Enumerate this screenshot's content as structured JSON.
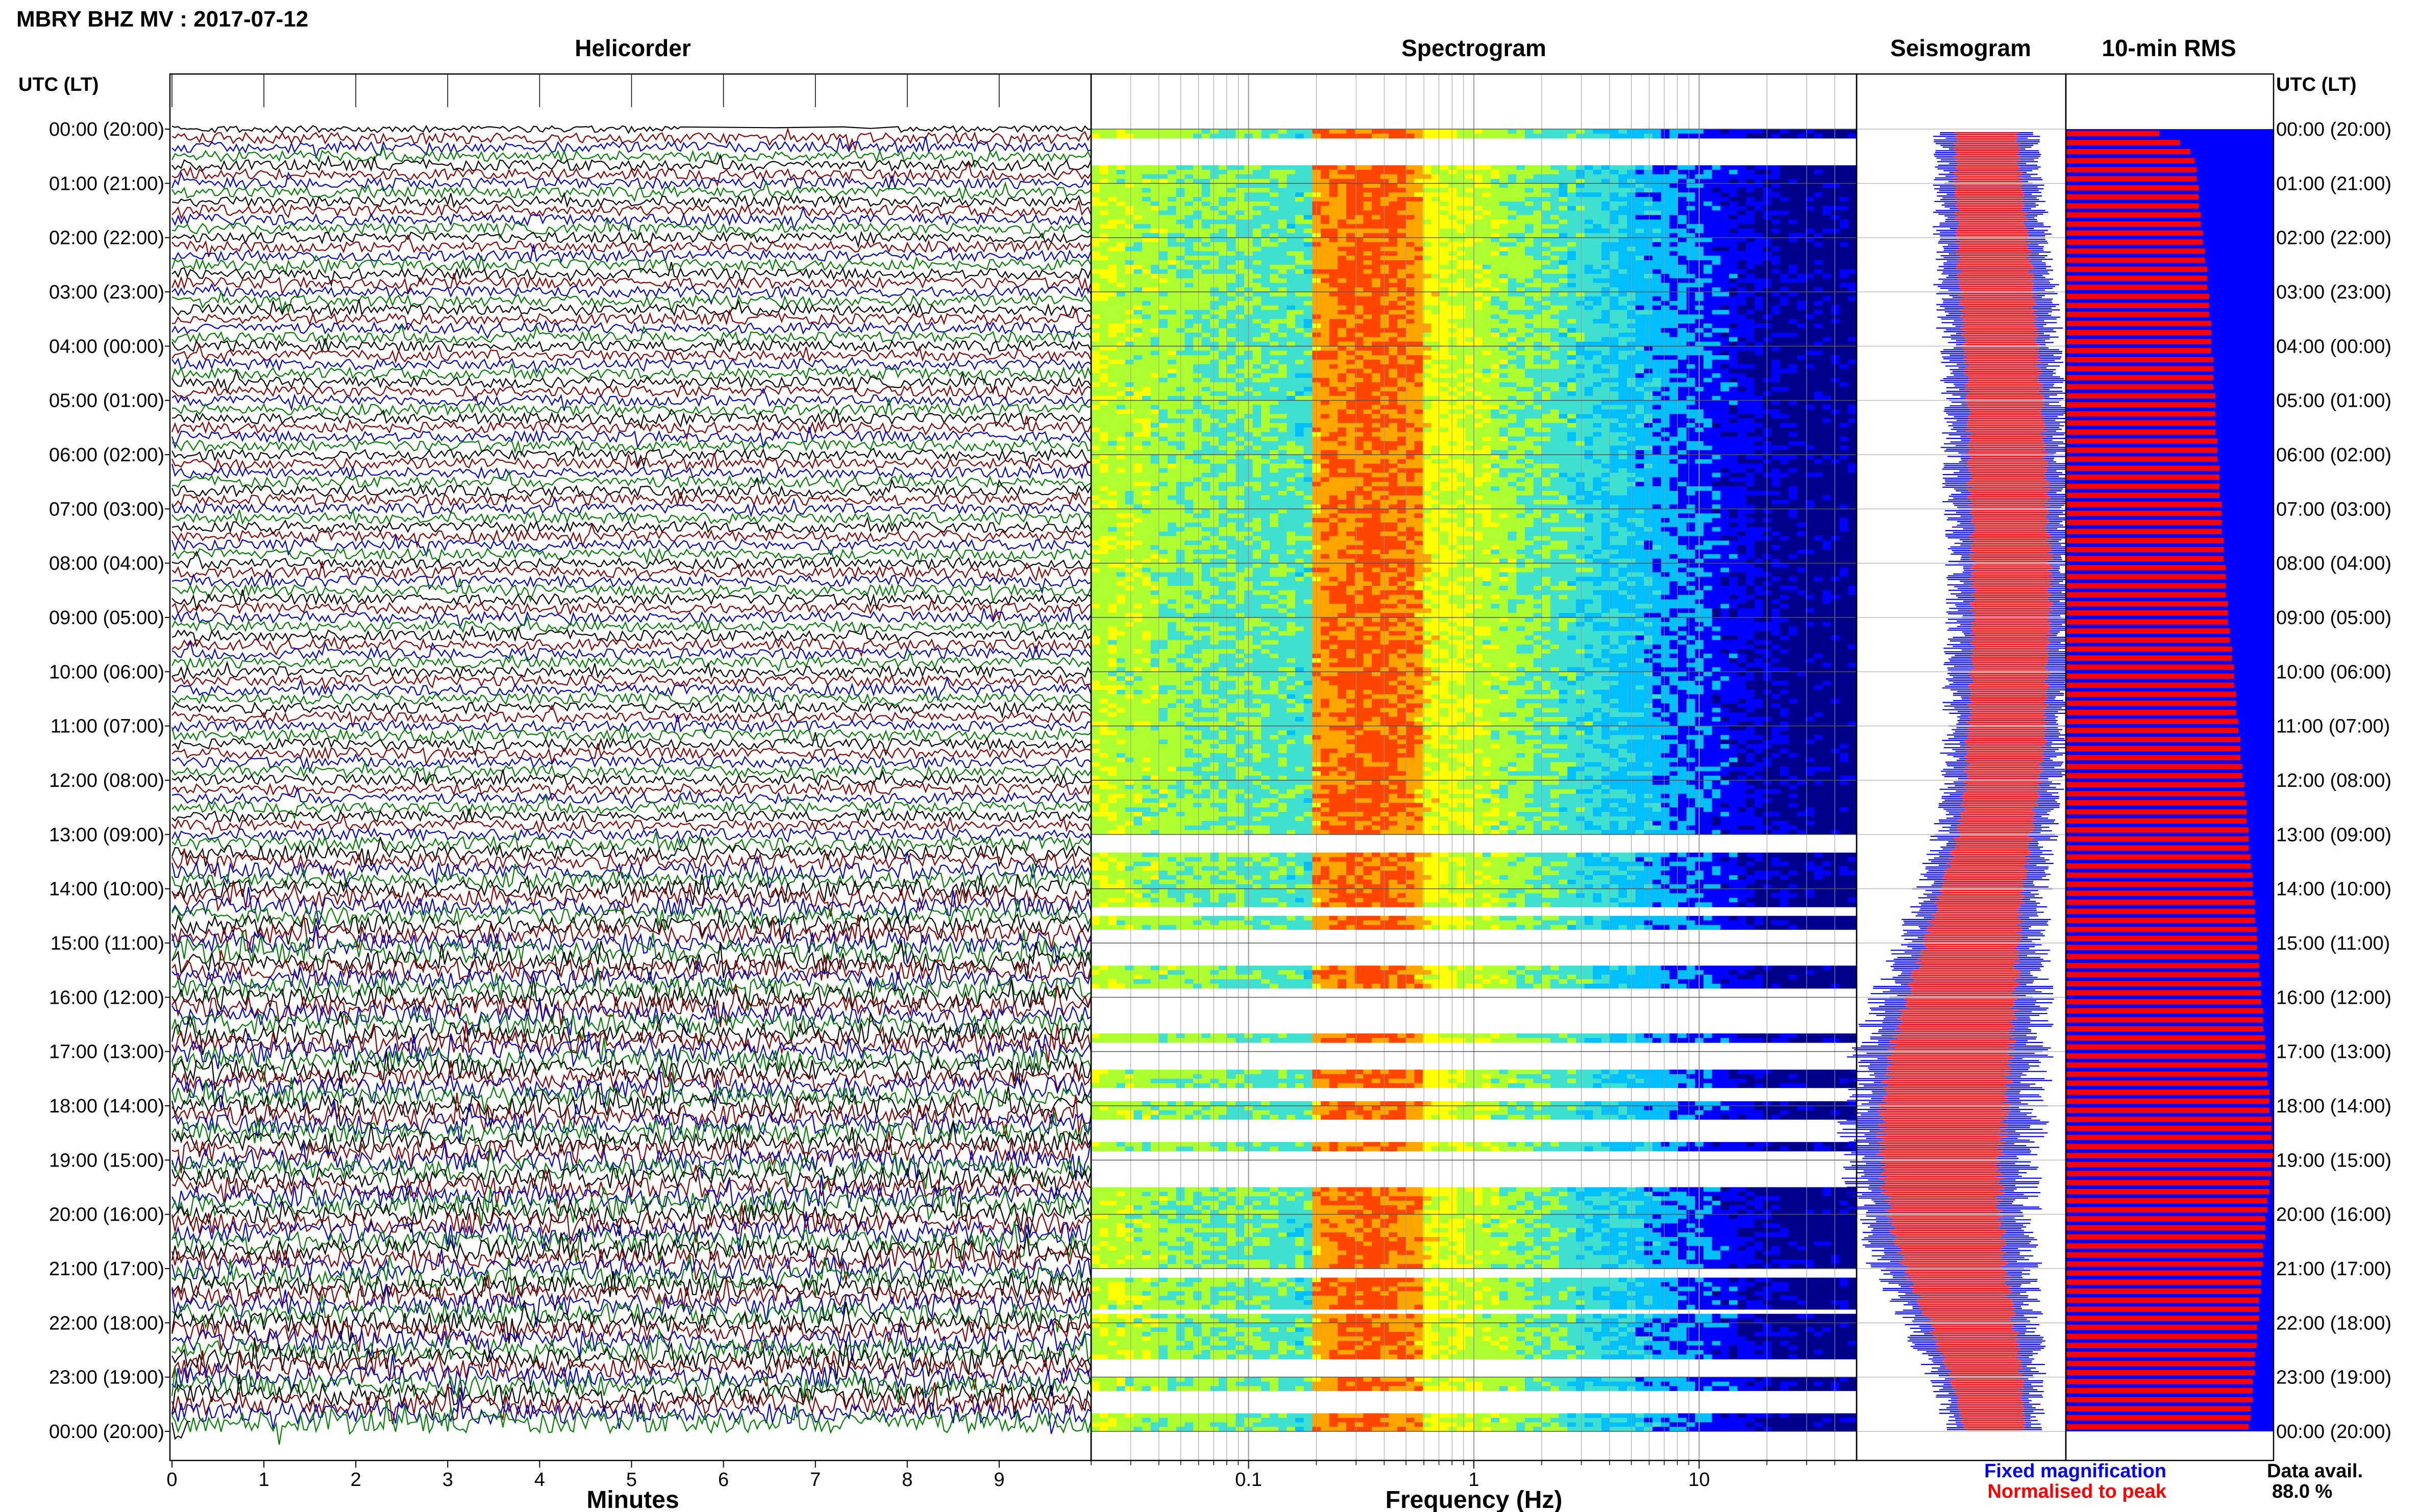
{
  "header": {
    "title": "MBRY BHZ MV : 2017-07-12"
  },
  "colors": {
    "trace_cycle": [
      "#000000",
      "#8b0000",
      "#0000cc",
      "#008000"
    ],
    "fixed_magnification": "#0000ff",
    "normalised_to_peak": "#ff0000",
    "spectrogram_colormap": [
      "#00008b",
      "#0000ff",
      "#00bfff",
      "#40e0d0",
      "#adff2f",
      "#ffff00",
      "#ffa500",
      "#ff4500"
    ]
  },
  "panels": {
    "helicorder": {
      "title": "Helicorder",
      "xlabel": "Minutes"
    },
    "spectrogram": {
      "title": "Spectrogram",
      "xlabel": "Frequency (Hz)"
    },
    "seismogram": {
      "title": "Seismogram"
    },
    "rms": {
      "title": "10-min RMS"
    }
  },
  "axis": {
    "left_header": "UTC (LT)",
    "right_header": "UTC (LT)",
    "time_labels": [
      "00:00 (20:00)",
      "01:00 (21:00)",
      "02:00 (22:00)",
      "03:00 (23:00)",
      "04:00 (00:00)",
      "05:00 (01:00)",
      "06:00 (02:00)",
      "07:00 (03:00)",
      "08:00 (04:00)",
      "09:00 (05:00)",
      "10:00 (06:00)",
      "11:00 (07:00)",
      "12:00 (08:00)",
      "13:00 (09:00)",
      "14:00 (10:00)",
      "15:00 (11:00)",
      "16:00 (12:00)",
      "17:00 (13:00)",
      "18:00 (14:00)",
      "19:00 (15:00)",
      "20:00 (16:00)",
      "21:00 (17:00)",
      "22:00 (18:00)",
      "23:00 (19:00)",
      "00:00 (20:00)"
    ],
    "minute_ticks": [
      "0",
      "1",
      "2",
      "3",
      "4",
      "5",
      "6",
      "7",
      "8",
      "9"
    ],
    "freq_ticks": [
      "0.1",
      "1",
      "10"
    ]
  },
  "legend": {
    "fixed": "Fixed magnification",
    "normalised": "Normalised to peak",
    "avail_label": "Data avail.",
    "avail_value": "88.0 %"
  },
  "chart_data": [
    {
      "type": "line",
      "title": "Helicorder",
      "xlabel": "Minutes",
      "ylabel": "UTC (LT)",
      "xlim": [
        0,
        10
      ],
      "ylim": [
        0,
        24
      ],
      "rows_per_hour": 6,
      "row_duration_minutes": 10,
      "row_activity": [
        0.15,
        0.55,
        0.55,
        0.55,
        0.55,
        0.55,
        0.55,
        0.55,
        0.55,
        0.55,
        0.55,
        0.55,
        0.55,
        0.55,
        0.55,
        0.55,
        0.55,
        0.55,
        0.55,
        0.55,
        0.55,
        0.55,
        0.55,
        0.55,
        0.55,
        0.55,
        0.55,
        0.55,
        0.55,
        0.55,
        0.55,
        0.55,
        0.55,
        0.55,
        0.55,
        0.55,
        0.55,
        0.55,
        0.55,
        0.55,
        0.55,
        0.55,
        0.55,
        0.55,
        0.55,
        0.55,
        0.55,
        0.55,
        0.55,
        0.55,
        0.55,
        0.55,
        0.55,
        0.55,
        0.55,
        0.55,
        0.55,
        0.55,
        0.55,
        0.55,
        0.55,
        0.55,
        0.55,
        0.55,
        0.55,
        0.55,
        0.55,
        0.55,
        0.55,
        0.55,
        0.55,
        0.55,
        0.55,
        0.55,
        0.55,
        0.55,
        0.55,
        0.55,
        0.6,
        0.7,
        0.75,
        0.8,
        0.85,
        0.8,
        0.85,
        0.9,
        0.9,
        0.85,
        0.9,
        0.95,
        1,
        1,
        0.95,
        1,
        0.9,
        1,
        1,
        1,
        1,
        1,
        1,
        1,
        1,
        1,
        1,
        0.9,
        1,
        0.95,
        1,
        1,
        1,
        1,
        1,
        1,
        1,
        1,
        1,
        1,
        1,
        1,
        1,
        1,
        1,
        1,
        1,
        1,
        1,
        1,
        1,
        1,
        1,
        1,
        1,
        1,
        1,
        1,
        1,
        1,
        1,
        1,
        1,
        1,
        1,
        1
      ]
    },
    {
      "type": "heatmap",
      "title": "Spectrogram",
      "xlabel": "Frequency (Hz)",
      "xscale": "log",
      "xlim": [
        0.02,
        50
      ],
      "ylim": [
        0,
        24
      ],
      "dominant_band_hz": [
        0.2,
        0.6
      ],
      "missing_hour_ranges": [
        [
          0.1,
          0.6
        ],
        [
          13.0,
          13.3
        ],
        [
          14.3,
          14.5
        ],
        [
          14.7,
          15.4
        ],
        [
          15.8,
          16.6
        ],
        [
          16.8,
          17.3
        ],
        [
          17.6,
          17.9
        ],
        [
          18.2,
          18.6
        ],
        [
          18.8,
          19.5
        ],
        [
          21.0,
          21.1
        ],
        [
          21.7,
          21.8
        ],
        [
          22.6,
          23.0
        ],
        [
          23.2,
          23.6
        ]
      ]
    },
    {
      "type": "area",
      "title": "Seismogram",
      "ylim": [
        0,
        24
      ],
      "series": [
        {
          "name": "Fixed magnification",
          "color": "#0000ff"
        },
        {
          "name": "Normalised to peak",
          "color": "#ff0000"
        }
      ],
      "center_offset": [
        0.62,
        0.63,
        0.65,
        0.67,
        0.69,
        0.71,
        0.72,
        0.73,
        0.74,
        0.74,
        0.73,
        0.72,
        0.7,
        0.66,
        0.6,
        0.55,
        0.5,
        0.45,
        0.42,
        0.4,
        0.42,
        0.47,
        0.55,
        0.62,
        0.66
      ],
      "half_width": [
        0.16,
        0.17,
        0.18,
        0.19,
        0.19,
        0.19,
        0.2,
        0.2,
        0.2,
        0.2,
        0.2,
        0.2,
        0.19,
        0.19,
        0.21,
        0.24,
        0.28,
        0.31,
        0.32,
        0.31,
        0.29,
        0.26,
        0.22,
        0.18,
        0.15
      ]
    },
    {
      "type": "bar",
      "title": "10-min RMS",
      "orientation": "horizontal",
      "series": [
        {
          "name": "Normalised to peak",
          "color": "#ff0000"
        }
      ],
      "xlim": [
        0,
        1
      ],
      "values": [
        0.45,
        0.55,
        0.6,
        0.62,
        0.63,
        0.63,
        0.64,
        0.64,
        0.64,
        0.65,
        0.65,
        0.66,
        0.66,
        0.67,
        0.67,
        0.68,
        0.68,
        0.68,
        0.69,
        0.69,
        0.69,
        0.7,
        0.7,
        0.7,
        0.7,
        0.71,
        0.71,
        0.71,
        0.71,
        0.72,
        0.72,
        0.72,
        0.72,
        0.72,
        0.73,
        0.73,
        0.73,
        0.74,
        0.74,
        0.74,
        0.74,
        0.75,
        0.75,
        0.75,
        0.75,
        0.76,
        0.76,
        0.76,
        0.77,
        0.77,
        0.77,
        0.77,
        0.78,
        0.78,
        0.78,
        0.79,
        0.79,
        0.8,
        0.8,
        0.81,
        0.81,
        0.81,
        0.82,
        0.82,
        0.82,
        0.83,
        0.83,
        0.84,
        0.84,
        0.84,
        0.85,
        0.85,
        0.86,
        0.86,
        0.87,
        0.87,
        0.87,
        0.88,
        0.88,
        0.88,
        0.89,
        0.89,
        0.9,
        0.9,
        0.9,
        0.91,
        0.91,
        0.91,
        0.92,
        0.92,
        0.92,
        0.93,
        0.93,
        0.93,
        0.94,
        0.94,
        0.94,
        0.95,
        0.95,
        0.95,
        0.96,
        0.96,
        0.96,
        0.97,
        0.97,
        0.97,
        0.98,
        0.98,
        0.98,
        0.99,
        0.99,
        0.99,
        1.0,
        1.0,
        0.99,
        0.99,
        0.98,
        0.98,
        0.97,
        0.97,
        0.96,
        0.96,
        0.96,
        0.95,
        0.95,
        0.95,
        0.94,
        0.94,
        0.94,
        0.93,
        0.93,
        0.93,
        0.92,
        0.92,
        0.92,
        0.91,
        0.91,
        0.91,
        0.9,
        0.9,
        0.9,
        0.89,
        0.89,
        0.88
      ]
    }
  ]
}
